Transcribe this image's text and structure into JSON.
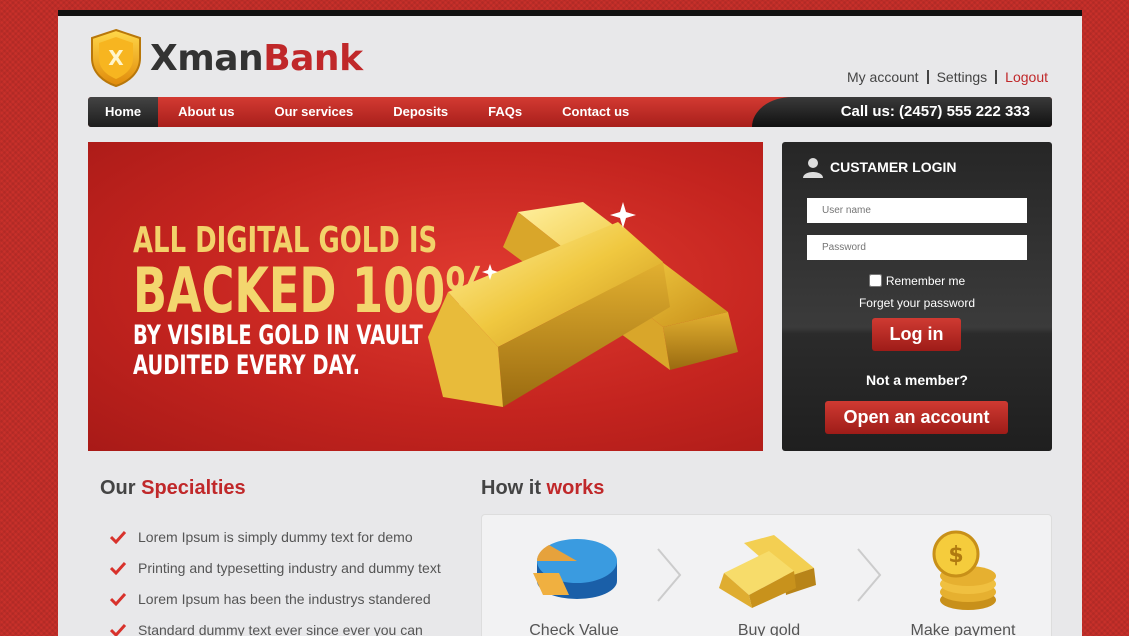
{
  "brand": {
    "part1": "Xman",
    "part2": "Bank",
    "shield_letter": "X"
  },
  "top_links": [
    "My account",
    "Settings",
    "Logout"
  ],
  "nav": {
    "items": [
      "Home",
      "About us",
      "Our services",
      "Deposits",
      "FAQs",
      "Contact us"
    ],
    "active": "Home",
    "call": "Call us: (2457) 555 222 333"
  },
  "hero": {
    "line1": "ALL DIGITAL GOLD IS",
    "line2": "BACKED 100%",
    "line3": "BY VISIBLE GOLD IN VAULT",
    "line4": "AUDITED EVERY DAY."
  },
  "login": {
    "title": "CUSTAMER LOGIN",
    "username_placeholder": "User name",
    "password_placeholder": "Password",
    "remember": "Remember me",
    "forget": "Forget your password",
    "login_button": "Log in",
    "not_member": "Not a member?",
    "open_button": "Open an account"
  },
  "specialties": {
    "title_a": "Our ",
    "title_b": "Specialties",
    "items": [
      "Lorem Ipsum is simply dummy text for demo",
      "Printing and typesetting industry and dummy text",
      "Lorem Ipsum has been the industrys standered",
      "Standard dummy text ever since ever you can"
    ]
  },
  "how": {
    "title_a": "How it ",
    "title_b": "works",
    "steps": [
      "Check Value",
      "Buy gold",
      "Make payment"
    ]
  },
  "colors": {
    "accent": "#c0282a",
    "dark": "#1f1f1f",
    "gold": "#f3d66e"
  }
}
